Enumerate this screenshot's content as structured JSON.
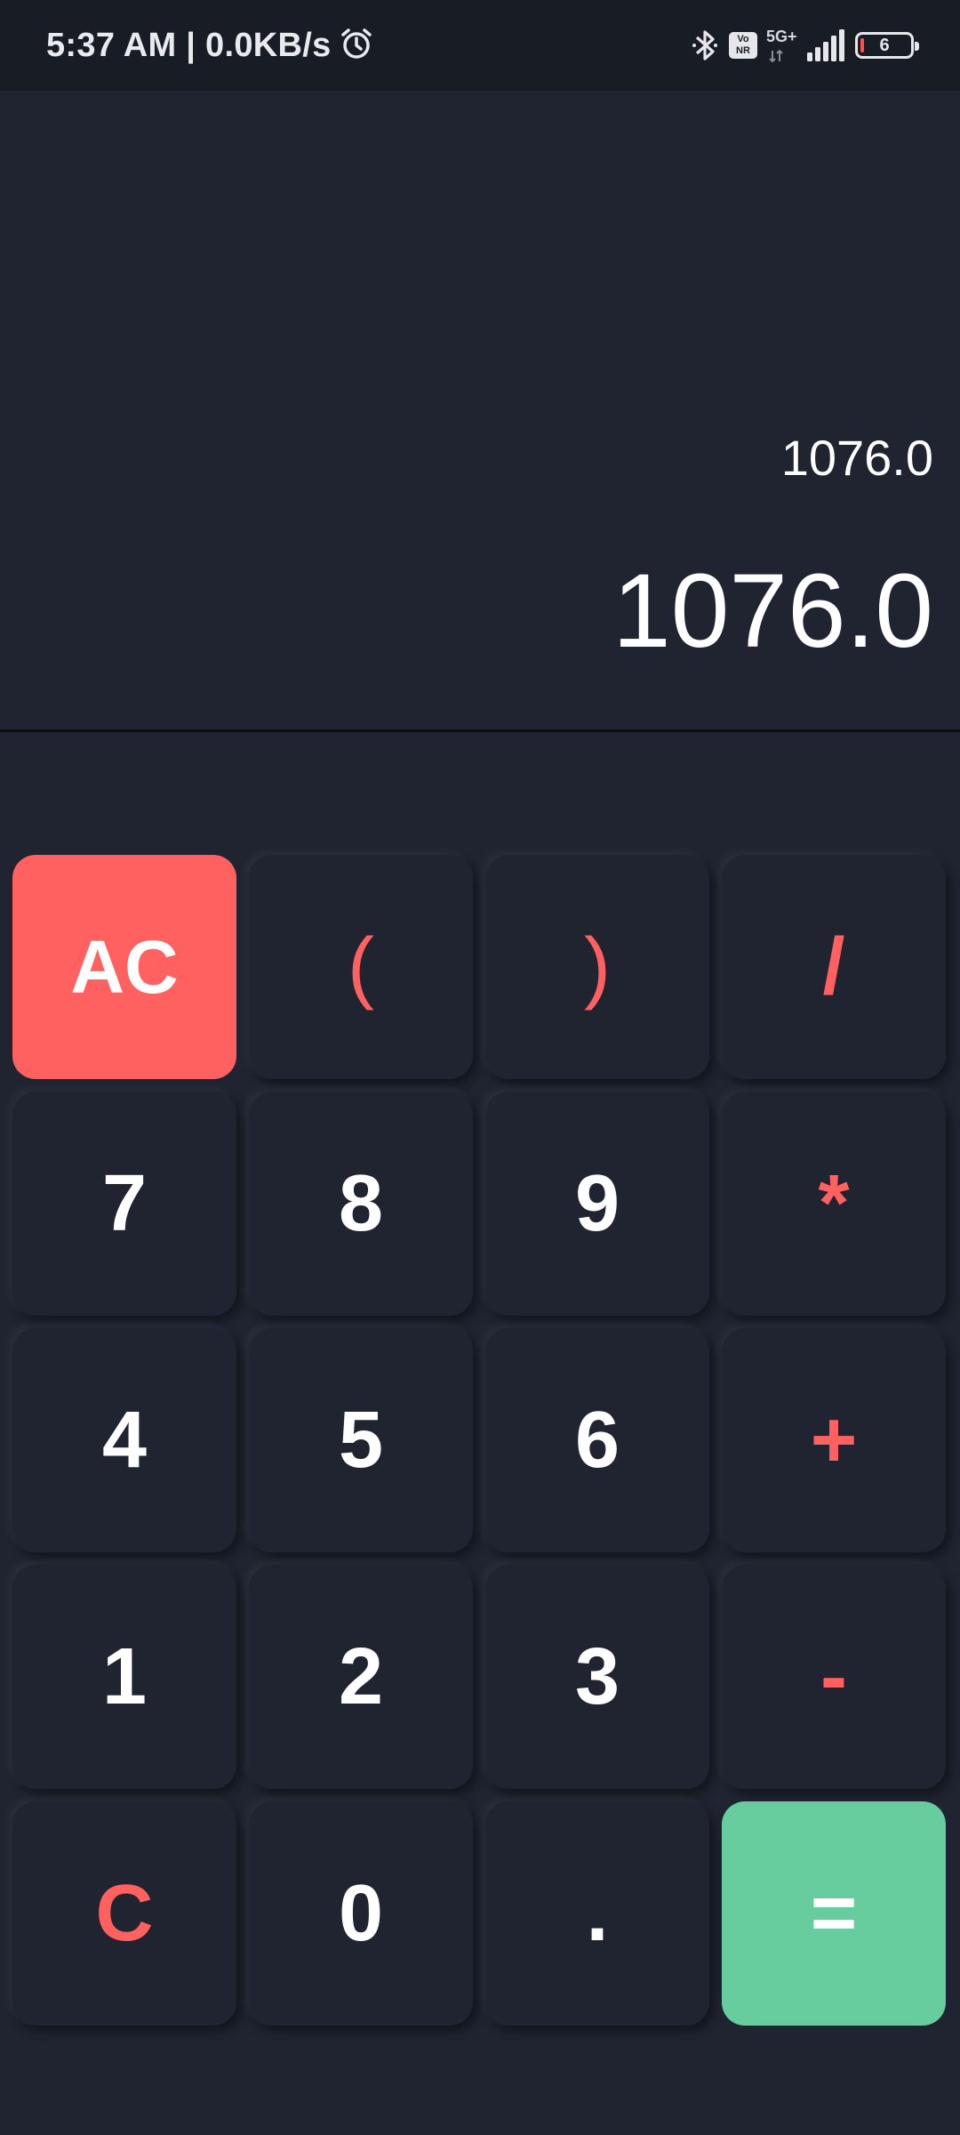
{
  "status_bar": {
    "time": "5:37 AM | 0.0KB/s",
    "network_type": "5G+",
    "vonr_label_top": "Vo",
    "vonr_label_bottom": "NR",
    "battery_level": "6"
  },
  "display": {
    "expression": "1076.0",
    "result": "1076.0"
  },
  "keypad": {
    "keys": [
      {
        "label": "AC"
      },
      {
        "label": "("
      },
      {
        "label": ")"
      },
      {
        "label": "/"
      },
      {
        "label": "7"
      },
      {
        "label": "8"
      },
      {
        "label": "9"
      },
      {
        "label": "*"
      },
      {
        "label": "4"
      },
      {
        "label": "5"
      },
      {
        "label": "6"
      },
      {
        "label": "+"
      },
      {
        "label": "1"
      },
      {
        "label": "2"
      },
      {
        "label": "3"
      },
      {
        "label": "-"
      },
      {
        "label": "C"
      },
      {
        "label": "0"
      },
      {
        "label": "."
      },
      {
        "label": "="
      }
    ]
  },
  "colors": {
    "background": "#1f2430",
    "status_bar": "#181c24",
    "accent_red": "#ff6161",
    "accent_green": "#67cd9e",
    "text": "#ffffff"
  }
}
